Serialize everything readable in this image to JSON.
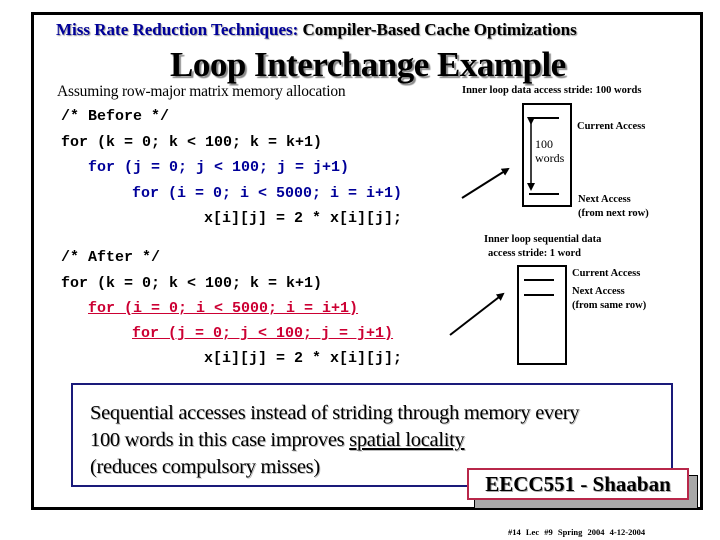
{
  "header": {
    "section": "Miss Rate Reduction Techniques:",
    "topic": "Compiler-Based Cache Optimizations"
  },
  "title": "Loop Interchange Example",
  "subtitle": "Assuming row-major matrix memory allocation",
  "before": {
    "comment": "/* Before */",
    "lines": [
      "for (k = 0; k < 100; k = k+1)",
      "for (j = 0; j < 100; j = j+1)",
      "for (i = 0; i < 5000; i = i+1)",
      "x[i][j] = 2 * x[i][j];"
    ]
  },
  "after": {
    "comment": "/* After */",
    "lines": [
      "for (k = 0; k < 100; k = k+1)",
      "for (i = 0; i < 5000; i = i+1)",
      "for (j = 0; j < 100; j = j+1)",
      "x[i][j] = 2 * x[i][j];"
    ]
  },
  "diagram_before": {
    "caption": "Inner loop data access stride: 100 words",
    "span_label_1": "100",
    "span_label_2": "words",
    "current": "Current Access",
    "next_1": "Next Access",
    "next_2": "(from next row)"
  },
  "diagram_after": {
    "caption_1": "Inner loop sequential data",
    "caption_2": "access stride: 1 word",
    "current": "Current Access",
    "next_1": "Next Access",
    "next_2": "(from same row)"
  },
  "summary": {
    "line1": "Sequential accesses instead of striding through memory every",
    "line2_prefix": "100 words in this case improves ",
    "line2_emph": "spatial locality",
    "line3": "(reduces compulsory misses)"
  },
  "footer": {
    "course": "EECC551 - Shaaban",
    "meta": "#14  Lec #9  Spring 2004   4-12-2004"
  },
  "colors": {
    "header_accent": "#000099",
    "code_inner": "#000099",
    "code_interchanged": "#cc0033",
    "summary_border": "#1a1a7a",
    "footer_border": "#b8274a"
  }
}
